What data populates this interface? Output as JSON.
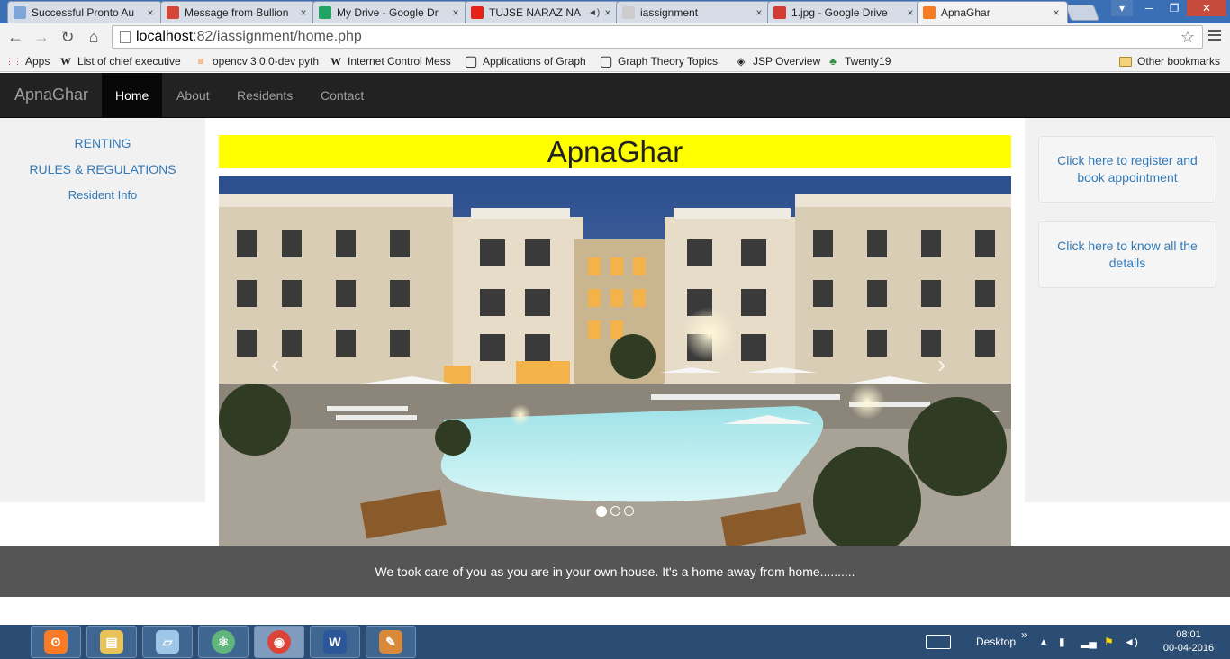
{
  "browser": {
    "tabs": [
      {
        "title": "Successful Pronto Au",
        "color": "#7ea6d8",
        "active": false
      },
      {
        "title": "Message from Bullion",
        "color": "#d44638",
        "active": false
      },
      {
        "title": "My Drive - Google Dr",
        "color": "#1fa463",
        "active": false
      },
      {
        "title": "TUJSE NARAZ NA",
        "color": "#e62117",
        "active": false
      },
      {
        "title": "iassignment",
        "color": "#cccccc",
        "active": false
      },
      {
        "title": "1.jpg - Google Drive",
        "color": "#d63b30",
        "active": false
      },
      {
        "title": "ApnaGhar",
        "color": "#f47b20",
        "active": true
      }
    ],
    "url_host": "localhost",
    "url_path": ":82/iassignment/home.php",
    "bookmarks": [
      {
        "label": "Apps",
        "icon": "apps-grid-icon",
        "glyph": "⋮⋮"
      },
      {
        "label": "List of chief executive",
        "icon": "wikipedia-icon",
        "glyph": "W"
      },
      {
        "label": "opencv 3.0.0-dev pyth",
        "icon": "stackoverflow-icon",
        "glyph": "≡"
      },
      {
        "label": "Internet Control Mess",
        "icon": "wikipedia-icon",
        "glyph": "W"
      },
      {
        "label": "Applications of Graph",
        "icon": "page-icon",
        "glyph": "▢"
      },
      {
        "label": "Graph Theory Topics",
        "icon": "page-icon",
        "glyph": "▢"
      },
      {
        "label": "JSP Overview",
        "icon": "jsp-icon",
        "glyph": "◈"
      },
      {
        "label": "Twenty19",
        "icon": "twenty19-icon",
        "glyph": "♣"
      }
    ],
    "other_bookmarks": "Other bookmarks"
  },
  "site": {
    "brand": "ApnaGhar",
    "nav": [
      "Home",
      "About",
      "Residents",
      "Contact"
    ],
    "active_nav": "Home",
    "left_links": [
      "RENTING",
      "RULES & REGULATIONS",
      "Resident Info"
    ],
    "title": "ApnaGhar",
    "right_wells": [
      "Click here to register and book appointment",
      "Click here to know all the details"
    ],
    "carousel": {
      "slides": 3,
      "active": 0,
      "prev": "‹",
      "next": "›"
    },
    "footer": "We took care of you as you are in your own house. It's a home away from home.........."
  },
  "taskbar": {
    "apps": [
      {
        "name": "xampp",
        "glyph": "ʘ",
        "color": "#fb7a24",
        "active": false
      },
      {
        "name": "file-explorer",
        "glyph": "▤",
        "color": "#e8c35a",
        "active": false
      },
      {
        "name": "notepad",
        "glyph": "▱",
        "color": "#9ec6e6",
        "active": false
      },
      {
        "name": "atom",
        "glyph": "⚛",
        "color": "#5fb57c",
        "active": false
      },
      {
        "name": "chrome",
        "glyph": "◉",
        "color": "#db4437",
        "active": true
      },
      {
        "name": "word",
        "glyph": "W",
        "color": "#2b579a",
        "active": false
      },
      {
        "name": "paint",
        "glyph": "✎",
        "color": "#d88a3a",
        "active": false
      }
    ],
    "desktop_label": "Desktop",
    "time": "08:01",
    "date": "00-04-2016"
  }
}
